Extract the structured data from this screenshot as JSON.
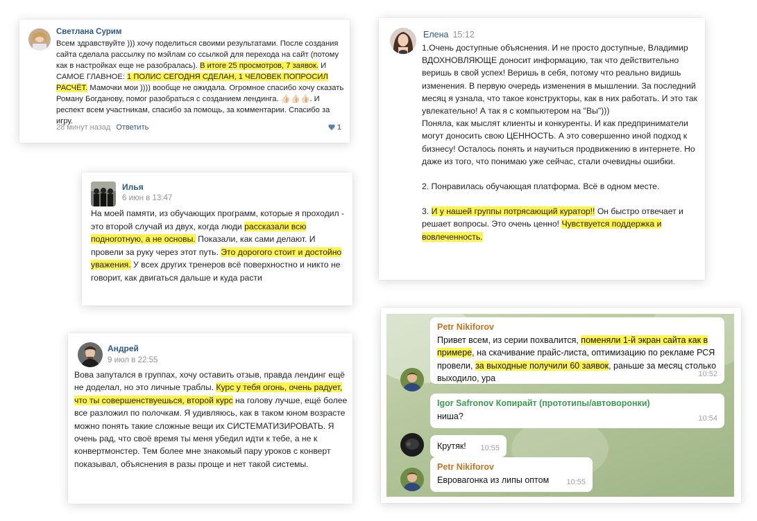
{
  "card1": {
    "author": "Светлана Сурим",
    "text_1": "Всем здравствуйте ))) хочу поделиться своими результатами. После создания сайта сделала рассылку по мэйлам со ссылкой для перехода на сайт (потому как в настройках еще не разобралась). ",
    "hl_1": "В итоге 25 просмотров, 7 заявок.",
    "text_2": " И САМОЕ ГЛАВНОЕ: ",
    "hl_2": "1 ПОЛИС СЕГОДНЯ СДЕЛАН, 1 ЧЕЛОВЕК ПОПРОСИЛ РАСЧЁТ.",
    "text_3": " Мамочки мои )))) вообще не ожидала. Огромное спасибо хочу сказать Роману Богданову, помог разобраться с созданием лендинга. ",
    "emoji": "👍🏻👍🏻👍🏻",
    "text_4": ". И респект всем участникам, спасибо за помощь, за комментарии. Спасибо за игру.",
    "time": "28 минут назад",
    "reply": "Ответить",
    "likes": "1"
  },
  "card2": {
    "author": "Илья",
    "date": "6 июн в 13:47",
    "text_1": "На моей памяти, из обучающих программ, которые я проходил - это второй случай из двух, когда люди ",
    "hl_1": "рассказали всю подноготную, а не основы.",
    "text_2": " Показали, как сами делают. И провели за руку через этот путь. ",
    "hl_2": "Это дорогого стоит и достойно уважения.",
    "text_3": " У всех других тренеров всё поверхностно и никто не говорит, как двигаться дальше и куда расти"
  },
  "card3": {
    "author": "Елена",
    "time": "15:12",
    "p1": "1.Очень доступные объяснения. И не просто доступные, Владимир ВДОХНОВЛЯЮЩЕ доносит информацию, так что действительно веришь в свой успех! Веришь в себя, потому что реально видишь изменения. В первую очередь изменения в мышлении. За последний месяц я узнала, что такое конструкторы, как в них работать. И это так увлекательно! А так я с компьютером на \"Вы\")))",
    "p1b": "Поняла, как мыслят клиенты и конкуренты. И как предприниматели могут доносить свою ЦЕННОСТЬ. А это совершенно иной подход к бизнесу! Осталось понять и научиться продвижению в интернете. Но даже из того, что понимаю уже сейчас, стали очевидны ошибки.",
    "p2": "2. Понравилась обучающая платформа. Всё в одном месте.",
    "p3_pre": "3. ",
    "p3_hl1": "И у нашей группы потрясающий куратор!!",
    "p3_mid": " Он быстро отвечает и решает вопросы. Это очень ценно! ",
    "p3_hl2": "Чувствуется поддержка и вовлеченность."
  },
  "card4": {
    "author": "Андрей",
    "date": "9 июл в 22:55",
    "text_1": "Вова запутался в группах, хочу оставить отзыв, правда лендинг ещё не доделал, но это личные траблы. ",
    "hl_1": "Курс у тебя огонь, очень радует, что ты совершенствуешься, второй курс",
    "text_2": " на голову лучше, ещё более все разложил по полочкам. Я удивляюсь, как в таком юном возрасте можно понять такие сложные вещи их СИСТЕМАТИЗИРОВАТЬ. Я очень рад, что своё время ты меня убедил идти к тебе, а не к конвертмонстер. Тем более мне знакомый пару уроков с конверт показывал, объяснения в разы проще и нет такой системы."
  },
  "telegram": {
    "msg1": {
      "who": "Petr Nikiforov",
      "text_1": "Привет всем, из серии похвалится, ",
      "hl_1": "поменяли 1-й экран сайта как в примере",
      "text_2": ", на скачивание прайс-листа, оптимизацию по рекламе РСЯ провели, ",
      "hl_2": "за выходные получили 60 заявок",
      "text_3": ", раньше за месяц столько выходило, ура",
      "time": "10:52"
    },
    "msg2": {
      "who": "Igor Safronov Копирайт (прототипы/автоворонки)",
      "text": "ниша?",
      "time": "10:54"
    },
    "msg3": {
      "text": "Крутяк!",
      "time": "10:55"
    },
    "msg4": {
      "who": "Petr Nikiforov",
      "text": "Евровагонка из липы оптом",
      "time": "10:55"
    }
  },
  "colors": {
    "highlight": "#fff34d",
    "vk_link": "#2a5885",
    "tg_orange": "#c4741f",
    "tg_green": "#3b9a4d"
  }
}
